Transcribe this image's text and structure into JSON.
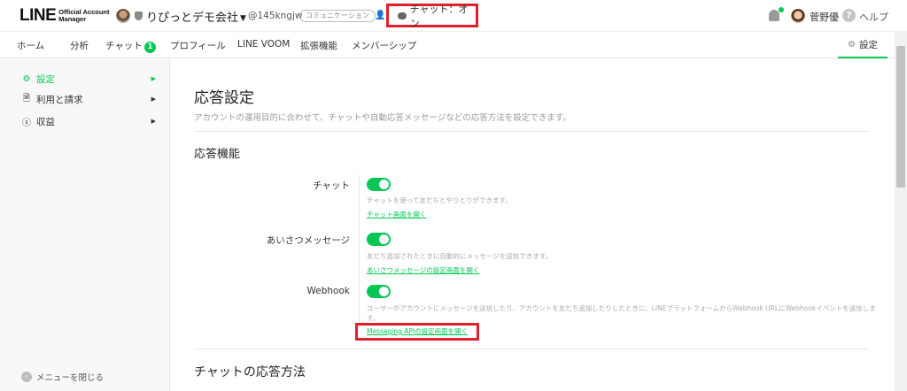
{
  "header": {
    "logo_main": "LINE",
    "logo_sub_line1": "Official Account",
    "logo_sub_line2": "Manager",
    "account_name": "りぴっとデモ会社",
    "account_id": "@145kngjw",
    "plan_badge": "コミュニケーション",
    "chat_status": "チャット：オン",
    "user_name": "菅野優",
    "help_label": "ヘルプ"
  },
  "nav": {
    "items": [
      "ホーム",
      "分析",
      "チャット",
      "プロフィール",
      "LINE VOOM",
      "拡張機能",
      "メンバーシップ"
    ],
    "chat_badge": "1",
    "settings_label": "設定"
  },
  "sidebar": {
    "items": [
      {
        "label": "設定",
        "icon": "gear-icon"
      },
      {
        "label": "利用と請求",
        "icon": "document-icon"
      },
      {
        "label": "収益",
        "icon": "dollar-icon"
      }
    ],
    "collapse_label": "メニューを閉じる"
  },
  "main": {
    "title": "応答設定",
    "description": "アカウントの運用目的に合わせて、チャットや自動応答メッセージなどの応答方法を設定できます。",
    "section1_title": "応答機能",
    "rows": [
      {
        "label": "チャット",
        "enabled": true,
        "desc": "チャットを使って友だちとやりとりができます。",
        "link": "チャット画面を開く"
      },
      {
        "label": "あいさつメッセージ",
        "enabled": true,
        "desc": "友だち追加されたときに自動的にメッセージを送信できます。",
        "link": "あいさつメッセージの設定画面を開く"
      },
      {
        "label": "Webhook",
        "enabled": true,
        "desc": "ユーザーがアカウントにメッセージを送信したり、アカウントを友だち追加したりしたときに、LINEプラットフォームからWebhook URLにWebhookイベントを送信します。",
        "link": "Messaging APIの設定画面を開く"
      }
    ],
    "section2_title": "チャットの応答方法"
  },
  "colors": {
    "accent": "#06c755",
    "highlight": "#e0202b"
  }
}
